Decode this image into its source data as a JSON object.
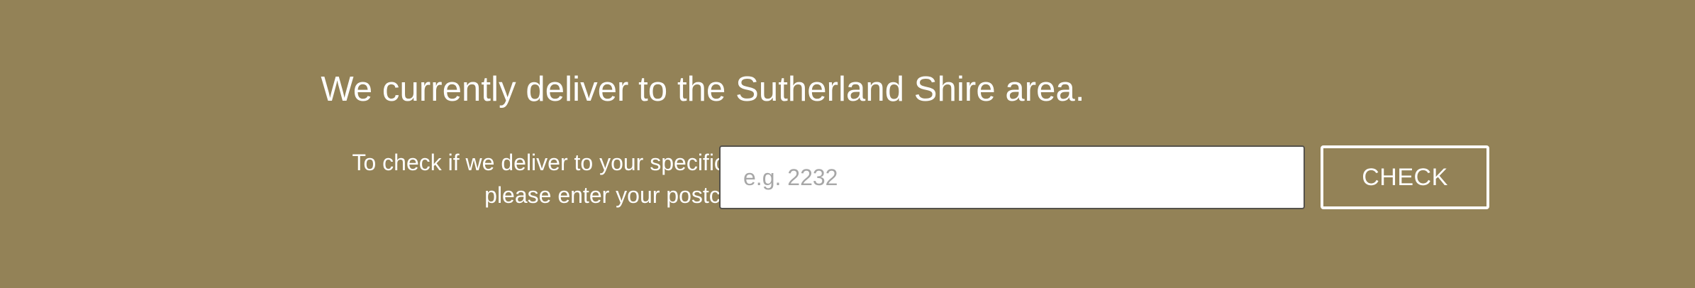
{
  "delivery_banner": {
    "headline": "We currently deliver to the Sutherland Shire area.",
    "instruction_line_1": "To check if we deliver to your specific location,",
    "instruction_line_2": "please enter your postcode here:",
    "postcode_input": {
      "value": "",
      "placeholder": "e.g. 2232"
    },
    "check_button_label": "CHECK"
  },
  "colors": {
    "background": "#938257",
    "text": "#ffffff",
    "input_background": "#ffffff",
    "input_border": "#55524b",
    "placeholder": "#a7a7a7",
    "button_border": "#ffffff"
  }
}
